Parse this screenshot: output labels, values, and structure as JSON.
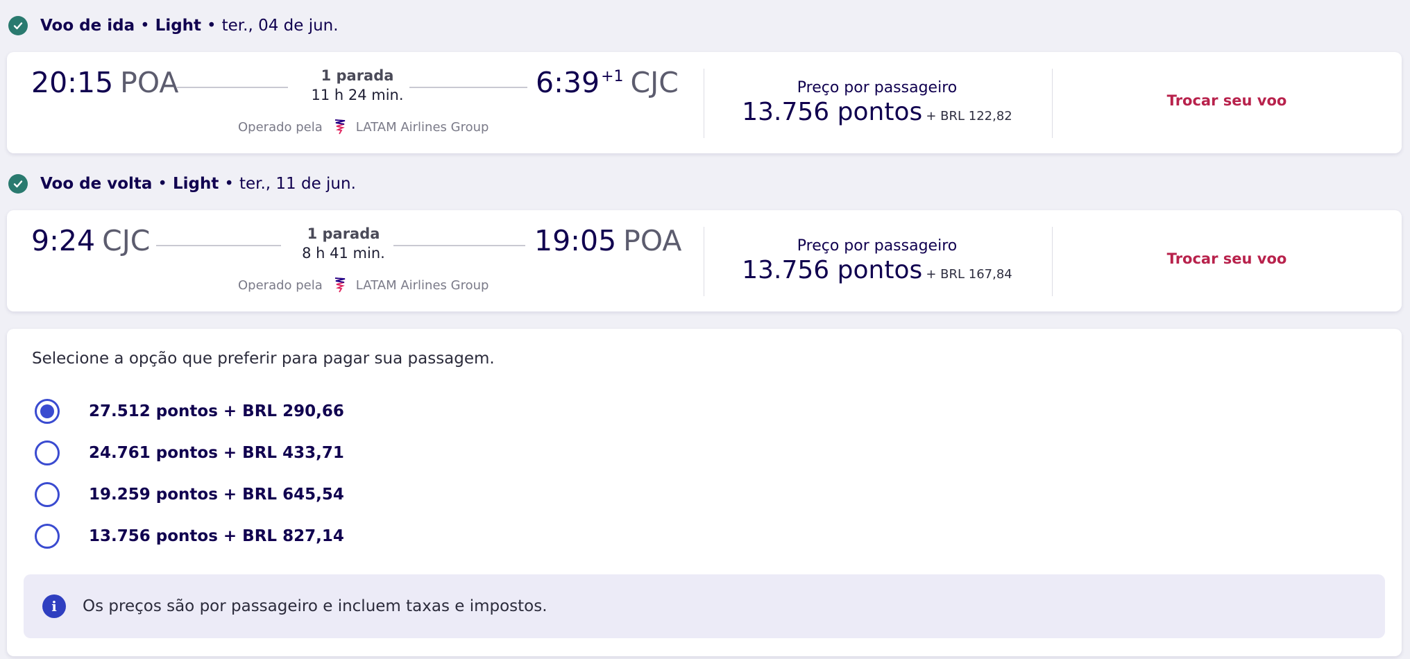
{
  "outbound": {
    "header": {
      "title": "Voo de ida",
      "fare": "Light",
      "date": "ter., 04 de jun."
    },
    "departure_time": "20:15",
    "departure_code": "POA",
    "stops": "1 parada",
    "duration": "11 h 24 min.",
    "arrival_time": "6:39",
    "arrival_day_offset": "+1",
    "arrival_code": "CJC",
    "operated_by_label": "Operado pela",
    "airline": "LATAM Airlines Group",
    "price_label": "Preço por passageiro",
    "price_points": "13.756 pontos",
    "price_extra": "+ BRL 122,82",
    "change_button": "Trocar seu voo"
  },
  "return": {
    "header": {
      "title": "Voo de volta",
      "fare": "Light",
      "date": "ter., 11 de jun."
    },
    "departure_time": "9:24",
    "departure_code": "CJC",
    "stops": "1 parada",
    "duration": "8 h 41 min.",
    "arrival_time": "19:05",
    "arrival_code": "POA",
    "operated_by_label": "Operado pela",
    "airline": "LATAM Airlines Group",
    "price_label": "Preço por passageiro",
    "price_points": "13.756 pontos",
    "price_extra": "+ BRL 167,84",
    "change_button": "Trocar seu voo"
  },
  "payment": {
    "intro": "Selecione a opção que preferir para pagar sua passagem.",
    "options": [
      {
        "label": "27.512 pontos + BRL 290,66",
        "selected": true
      },
      {
        "label": "24.761 pontos + BRL 433,71",
        "selected": false
      },
      {
        "label": "19.259 pontos + BRL 645,54",
        "selected": false
      },
      {
        "label": "13.756 pontos + BRL 827,14",
        "selected": false
      }
    ],
    "info": "Os preços são por passageiro e incluem taxas e impostos."
  },
  "colors": {
    "accent": "#3a4bd0",
    "primary_text": "#10004f",
    "change_link": "#b8224c",
    "check": "#2a7a6f"
  },
  "icons": [
    "check-circle-icon",
    "latam-logo-icon",
    "info-icon"
  ]
}
